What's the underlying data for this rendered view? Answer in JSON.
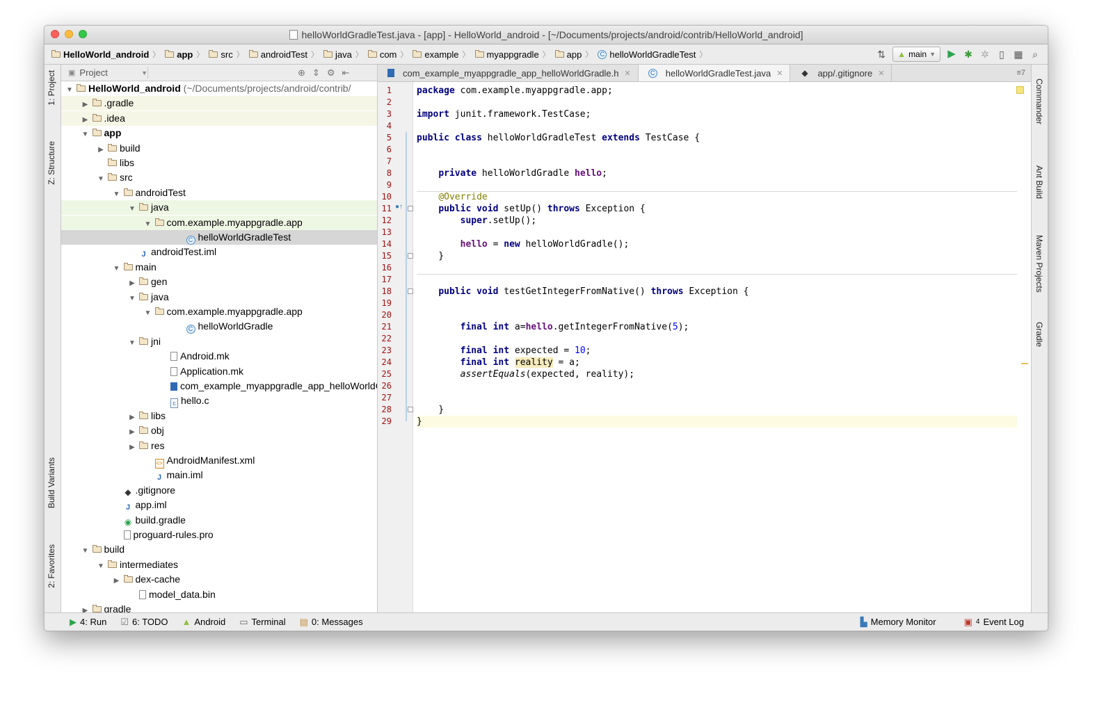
{
  "window": {
    "title": "helloWorldGradleTest.java - [app] - HelloWorld_android - [~/Documents/projects/android/contrib/HelloWorld_android]"
  },
  "breadcrumbs": [
    "HelloWorld_android",
    "app",
    "src",
    "androidTest",
    "java",
    "com",
    "example",
    "myappgradle",
    "app",
    "helloWorldGradleTest"
  ],
  "toolbar": {
    "run_config": "main",
    "icons": [
      "sync-icon",
      "run-icon",
      "debug-icon",
      "attach-icon",
      "device-icon",
      "structure-icon",
      "search-icon"
    ]
  },
  "left_tabs": {
    "project": "1: Project",
    "structure": "Z: Structure",
    "build_variants": "Build Variants",
    "favorites": "2: Favorites"
  },
  "right_tabs": {
    "commander": "Commander",
    "ant_build": "Ant Build",
    "maven": "Maven Projects",
    "gradle": "Gradle"
  },
  "project_panel": {
    "title": "Project",
    "root_label": "HelloWorld_android",
    "root_path": "(~/Documents/projects/android/contrib/",
    "items": [
      {
        "label": ".gradle",
        "indent": 1,
        "arrow": "right",
        "icon": "folder"
      },
      {
        "label": ".idea",
        "indent": 1,
        "arrow": "right",
        "icon": "folder"
      },
      {
        "label": "app",
        "indent": 1,
        "arrow": "down",
        "icon": "folder",
        "bold": true
      },
      {
        "label": "build",
        "indent": 2,
        "arrow": "right",
        "icon": "folder"
      },
      {
        "label": "libs",
        "indent": 2,
        "arrow": "",
        "icon": "folder"
      },
      {
        "label": "src",
        "indent": 2,
        "arrow": "down",
        "icon": "folder"
      },
      {
        "label": "androidTest",
        "indent": 3,
        "arrow": "down",
        "icon": "folder"
      },
      {
        "label": "java",
        "indent": 4,
        "arrow": "down",
        "icon": "folder",
        "state": "green"
      },
      {
        "label": "com.example.myappgradle.app",
        "indent": 5,
        "arrow": "down",
        "icon": "folder",
        "state": "green"
      },
      {
        "label": "helloWorldGradleTest",
        "indent": 7,
        "arrow": "",
        "icon": "class",
        "state": "selected"
      },
      {
        "label": "androidTest.iml",
        "indent": 4,
        "arrow": "",
        "icon": "iml"
      },
      {
        "label": "main",
        "indent": 3,
        "arrow": "down",
        "icon": "folder"
      },
      {
        "label": "gen",
        "indent": 4,
        "arrow": "right",
        "icon": "folder"
      },
      {
        "label": "java",
        "indent": 4,
        "arrow": "down",
        "icon": "folder"
      },
      {
        "label": "com.example.myappgradle.app",
        "indent": 5,
        "arrow": "down",
        "icon": "folder"
      },
      {
        "label": "helloWorldGradle",
        "indent": 7,
        "arrow": "",
        "icon": "class"
      },
      {
        "label": "jni",
        "indent": 4,
        "arrow": "down",
        "icon": "folder"
      },
      {
        "label": "Android.mk",
        "indent": 6,
        "arrow": "",
        "icon": "file"
      },
      {
        "label": "Application.mk",
        "indent": 6,
        "arrow": "",
        "icon": "file"
      },
      {
        "label": "com_example_myappgradle_app_helloWorldG",
        "indent": 6,
        "arrow": "",
        "icon": "h"
      },
      {
        "label": "hello.c",
        "indent": 6,
        "arrow": "",
        "icon": "c"
      },
      {
        "label": "libs",
        "indent": 4,
        "arrow": "right",
        "icon": "folder"
      },
      {
        "label": "obj",
        "indent": 4,
        "arrow": "right",
        "icon": "folder"
      },
      {
        "label": "res",
        "indent": 4,
        "arrow": "right",
        "icon": "folder"
      },
      {
        "label": "AndroidManifest.xml",
        "indent": 5,
        "arrow": "",
        "icon": "xml"
      },
      {
        "label": "main.iml",
        "indent": 5,
        "arrow": "",
        "icon": "iml"
      },
      {
        "label": ".gitignore",
        "indent": 3,
        "arrow": "",
        "icon": "git"
      },
      {
        "label": "app.iml",
        "indent": 3,
        "arrow": "",
        "icon": "iml"
      },
      {
        "label": "build.gradle",
        "indent": 3,
        "arrow": "",
        "icon": "gradle"
      },
      {
        "label": "proguard-rules.pro",
        "indent": 3,
        "arrow": "",
        "icon": "file"
      },
      {
        "label": "build",
        "indent": 1,
        "arrow": "down",
        "icon": "folder"
      },
      {
        "label": "intermediates",
        "indent": 2,
        "arrow": "down",
        "icon": "folder"
      },
      {
        "label": "dex-cache",
        "indent": 3,
        "arrow": "right",
        "icon": "folder"
      },
      {
        "label": "model_data.bin",
        "indent": 4,
        "arrow": "",
        "icon": "file"
      },
      {
        "label": "gradle",
        "indent": 1,
        "arrow": "right",
        "icon": "folder"
      }
    ]
  },
  "editor_tabs": [
    {
      "label": "com_example_myappgradle_app_helloWorldGradle.h",
      "icon": "h-icon",
      "active": false
    },
    {
      "label": "helloWorldGradleTest.java",
      "icon": "class-icon",
      "active": true
    },
    {
      "label": "app/.gitignore",
      "icon": "git-icon",
      "active": false
    }
  ],
  "tab_overflow": "≡7",
  "code_lines": [
    [
      {
        "t": "package",
        "c": "kw"
      },
      {
        "t": " com.example.myappgradle.app;"
      }
    ],
    [],
    [
      {
        "t": "import",
        "c": "kw"
      },
      {
        "t": " junit.framework.TestCase;"
      }
    ],
    [],
    [
      {
        "t": "public",
        "c": "kw"
      },
      {
        "t": " "
      },
      {
        "t": "class",
        "c": "kw"
      },
      {
        "t": " helloWorldGradleTest "
      },
      {
        "t": "extends",
        "c": "kw"
      },
      {
        "t": " TestCase {"
      }
    ],
    [],
    [],
    [
      {
        "t": "    "
      },
      {
        "t": "private",
        "c": "kw"
      },
      {
        "t": " helloWorldGradle "
      },
      {
        "t": "hello",
        "c": "fld"
      },
      {
        "t": ";"
      }
    ],
    [],
    [
      {
        "t": "    "
      },
      {
        "t": "@Override",
        "c": "ann"
      }
    ],
    [
      {
        "t": "    "
      },
      {
        "t": "public",
        "c": "kw"
      },
      {
        "t": " "
      },
      {
        "t": "void",
        "c": "kw"
      },
      {
        "t": " setUp() "
      },
      {
        "t": "throws",
        "c": "kw"
      },
      {
        "t": " Exception {"
      }
    ],
    [
      {
        "t": "        "
      },
      {
        "t": "super",
        "c": "kw"
      },
      {
        "t": ".setUp();"
      }
    ],
    [],
    [
      {
        "t": "        "
      },
      {
        "t": "hello",
        "c": "fld"
      },
      {
        "t": " = "
      },
      {
        "t": "new",
        "c": "kw"
      },
      {
        "t": " helloWorldGradle();"
      }
    ],
    [
      {
        "t": "    }"
      }
    ],
    [],
    [],
    [
      {
        "t": "    "
      },
      {
        "t": "public",
        "c": "kw"
      },
      {
        "t": " "
      },
      {
        "t": "void",
        "c": "kw"
      },
      {
        "t": " testGetIntegerFromNative() "
      },
      {
        "t": "throws",
        "c": "kw"
      },
      {
        "t": " Exception {"
      }
    ],
    [],
    [],
    [
      {
        "t": "        "
      },
      {
        "t": "final",
        "c": "kw"
      },
      {
        "t": " "
      },
      {
        "t": "int",
        "c": "kw"
      },
      {
        "t": " a="
      },
      {
        "t": "hello",
        "c": "fld"
      },
      {
        "t": ".getIntegerFromNative("
      },
      {
        "t": "5",
        "c": "num"
      },
      {
        "t": ");"
      }
    ],
    [],
    [
      {
        "t": "        "
      },
      {
        "t": "final",
        "c": "kw"
      },
      {
        "t": " "
      },
      {
        "t": "int",
        "c": "kw"
      },
      {
        "t": " expected = "
      },
      {
        "t": "10",
        "c": "num"
      },
      {
        "t": ";"
      }
    ],
    [
      {
        "t": "        "
      },
      {
        "t": "final",
        "c": "kw"
      },
      {
        "t": " "
      },
      {
        "t": "int",
        "c": "kw"
      },
      {
        "t": " "
      },
      {
        "t": "reality",
        "c": "rhl"
      },
      {
        "t": " = a;"
      }
    ],
    [
      {
        "t": "        "
      },
      {
        "t": "assertEquals",
        "c": "it"
      },
      {
        "t": "(expected, reality);"
      }
    ],
    [],
    [],
    [
      {
        "t": "    }"
      }
    ],
    [
      {
        "t": "}"
      }
    ]
  ],
  "statusbar": {
    "run": "4: Run",
    "todo": "6: TODO",
    "android": "Android",
    "terminal": "Terminal",
    "messages": "0: Messages",
    "memory": "Memory Monitor",
    "event_log": "Event Log",
    "event_count": "4"
  }
}
